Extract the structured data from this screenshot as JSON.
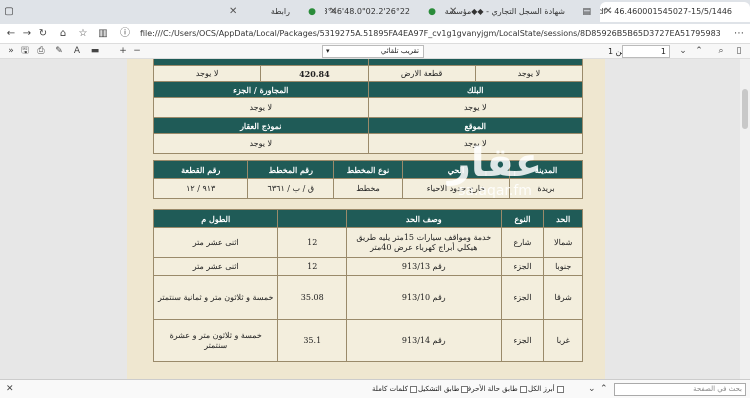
{
  "tabs": [
    {
      "title": "460001545027-15/5/1446.pdf - 46",
      "active": true
    },
    {
      "title": "شهادة السجل التجاري - ◆◆مؤسسة",
      "active": false
    },
    {
      "title": "26°22'02.2\"N 43°46'48.0\"",
      "active": false
    },
    {
      "title": "رابطة",
      "active": false
    }
  ],
  "address": "file:///C:/Users/OCS/AppData/Local/Packages/5319275A.51895FA4EA97F_cv1g1gvanyjgm/LocalState/sessions/8D85926B5B65D3727EA517959833A41",
  "pdf_toolbar": {
    "zoom": "تقريب تلقائي",
    "page_current": "1",
    "page_total": "من 1"
  },
  "watermark": {
    "logo": "عقار",
    "url": "sa.aqar.fm"
  },
  "top_rows": {
    "r1": {
      "a": "لا يوجد",
      "b": "قطعة الارض",
      "c": "420.84",
      "d": "لا يوجد"
    },
    "h2": {
      "a": "البلك",
      "b": "المجاورة / الجزء"
    },
    "r2": {
      "a": "لا يوجد",
      "b": "لا يوجد"
    },
    "h3": {
      "a": "الموقع",
      "b": "نموذج العقار"
    },
    "r3": {
      "a": "لا يوجد",
      "b": "لا يوجد"
    }
  },
  "location_table": {
    "headers": [
      "المدينة",
      "الحي",
      "نوع المخطط",
      "رقم المخطط",
      "رقم القطعة"
    ],
    "row": [
      "بريدة",
      "خارج حدود الاحياء",
      "مخطط",
      "ق / ب / ٦٣٦١",
      "٩١٣ / ١٢"
    ]
  },
  "bounds_table": {
    "headers": [
      "الحد",
      "النوع",
      "وصف الحد",
      "",
      "الطول م"
    ],
    "rows": [
      {
        "dir": "شمالا",
        "type": "شارع",
        "desc": "خدمة ومواقف سيارات 15متر يليه طريق هيكلي أبراج كهرباء عرض 40متر",
        "num": "12",
        "words": "اثنى عشر متر"
      },
      {
        "dir": "جنوبا",
        "type": "الجزء",
        "desc": "رقم 913/13",
        "num": "12",
        "words": "اثنى عشر متر"
      },
      {
        "dir": "شرقا",
        "type": "الجزء",
        "desc": "رقم 913/10",
        "num": "35.08",
        "words": "خمسة و ثلاثون متر و ثمانية سنتمتر"
      },
      {
        "dir": "غربا",
        "type": "الجزء",
        "desc": "رقم 913/14",
        "num": "35.1",
        "words": "خمسة و ثلاثون متر و عشرة سنتمتر"
      }
    ]
  },
  "findbar": {
    "placeholder": "بحث في الصفحة",
    "opt_all": "أبرز الكل",
    "opt_case": "طابق حالة الأحرف",
    "opt_diacritics": "طابق التشكيل",
    "opt_whole": "كلمات كاملة"
  }
}
